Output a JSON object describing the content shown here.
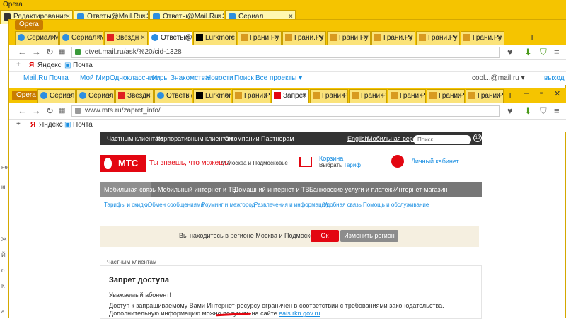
{
  "window1": {
    "app_name": "Opera",
    "tabs": [
      {
        "label": "Редактирование",
        "close": "×",
        "color": "#4a4a4a"
      },
      {
        "label": "Ответы@Mail.Ru: Задач",
        "close": "×",
        "color": "#2d8ee0"
      },
      {
        "label": "Ответы@Mail.Ru: Задач",
        "close": "×",
        "color": "#2d8ee0"
      },
      {
        "label": "Сериал",
        "close": "×",
        "color": "#2d8ee0"
      }
    ],
    "left_numbers": [
      "не",
      "кі",
      "",
      "Ж",
      "Й",
      "о",
      "К",
      "а"
    ]
  },
  "window2": {
    "app_name": "Opera",
    "tabs": [
      {
        "label": "Сериал М",
        "active": false
      },
      {
        "label": "Сериал 'М",
        "active": false
      },
      {
        "label": "Звездн",
        "active": false
      },
      {
        "label": "Ответы@",
        "active": true
      },
      {
        "label": "Lurkmore",
        "active": false
      },
      {
        "label": "Грани.Ру",
        "active": false
      },
      {
        "label": "Грани.Ру",
        "active": false
      },
      {
        "label": "Грани.Ру",
        "active": false
      },
      {
        "label": "Грани.Ру",
        "active": false
      },
      {
        "label": "Грани.Ру",
        "active": false
      },
      {
        "label": "Грани.Ру",
        "active": false
      }
    ],
    "address": "otvet.mail.ru/ask/%20/cid-1328",
    "bookmarks": [
      "Яндекс",
      "Почта"
    ],
    "mail_nav": [
      "Mail.Ru",
      "Почта",
      "Мой Мир",
      "Одноклассники",
      "Игры",
      "Знакомства",
      "Новости",
      "Поиск",
      "Все проекты ▾"
    ],
    "user_email": "cool...@mail.ru ▾",
    "logout": "выход"
  },
  "window3": {
    "app_name": "Opera",
    "tabs": [
      {
        "label": "Сериал 'М",
        "active": false
      },
      {
        "label": "Сериал 'М",
        "active": false
      },
      {
        "label": "Звездн",
        "active": false
      },
      {
        "label": "Ответы@",
        "active": false
      },
      {
        "label": "Lurkmore",
        "active": false
      },
      {
        "label": "Грани.Ру",
        "active": false
      },
      {
        "label": "Запрет",
        "active": true
      },
      {
        "label": "Грани.Ру",
        "active": false
      },
      {
        "label": "Грани.Ру",
        "active": false
      },
      {
        "label": "Грани.Ру",
        "active": false
      },
      {
        "label": "Грани.Ру",
        "active": false
      },
      {
        "label": "Грани.Ру",
        "active": false
      }
    ],
    "address": "www.mts.ru/zapret_info/",
    "bookmarks": [
      "Яндекс",
      "Почта"
    ]
  },
  "mts": {
    "top_nav": [
      "Частным клиентам",
      "Корпоративным клиентам",
      "О компании",
      "Партнерам"
    ],
    "english": "English",
    "mobile": "Мобильная версия",
    "search_placeholder": "Поиск",
    "logo": "МТС",
    "slogan": "Ты знаешь, что можешь!",
    "region": "Москва и Подмосковье",
    "basket": "Корзина",
    "basket_sub_prefix": "Выбрать ",
    "basket_sub_link": "Тариф",
    "cabinet": "Личный кабинет",
    "menu": [
      "Мобильная связь",
      "Мобильный интернет и ТВ",
      "Домашний интернет и ТВ",
      "Банковские услуги и платежи",
      "Интернет-магазин"
    ],
    "submenu": [
      "Тарифы и скидки",
      "Обмен сообщениями",
      "Роуминг и межгород",
      "Развлечения и информация",
      "Удобная связь",
      "Помощь и обслуживание"
    ],
    "banner_text": "Вы находитесь в регионе Москва и Подмосковье.",
    "ok": "Ок",
    "change_region": "Изменить регион",
    "breadcrumb": "Частным клиентам",
    "heading": "Запрет доступа",
    "greeting": "Уважаемый абонент!",
    "body_text": "Доступ к запрашиваемому Вами Интернет-ресурсу ограничен в соответствии с требованиями законодательства. Дополнительную информацию можно получить на сайте ",
    "body_link": "eais.rkn.gov.ru"
  },
  "colors": {
    "opera_yellow": "#f5c400",
    "mts_red": "#e30611",
    "link_blue": "#168de2"
  }
}
